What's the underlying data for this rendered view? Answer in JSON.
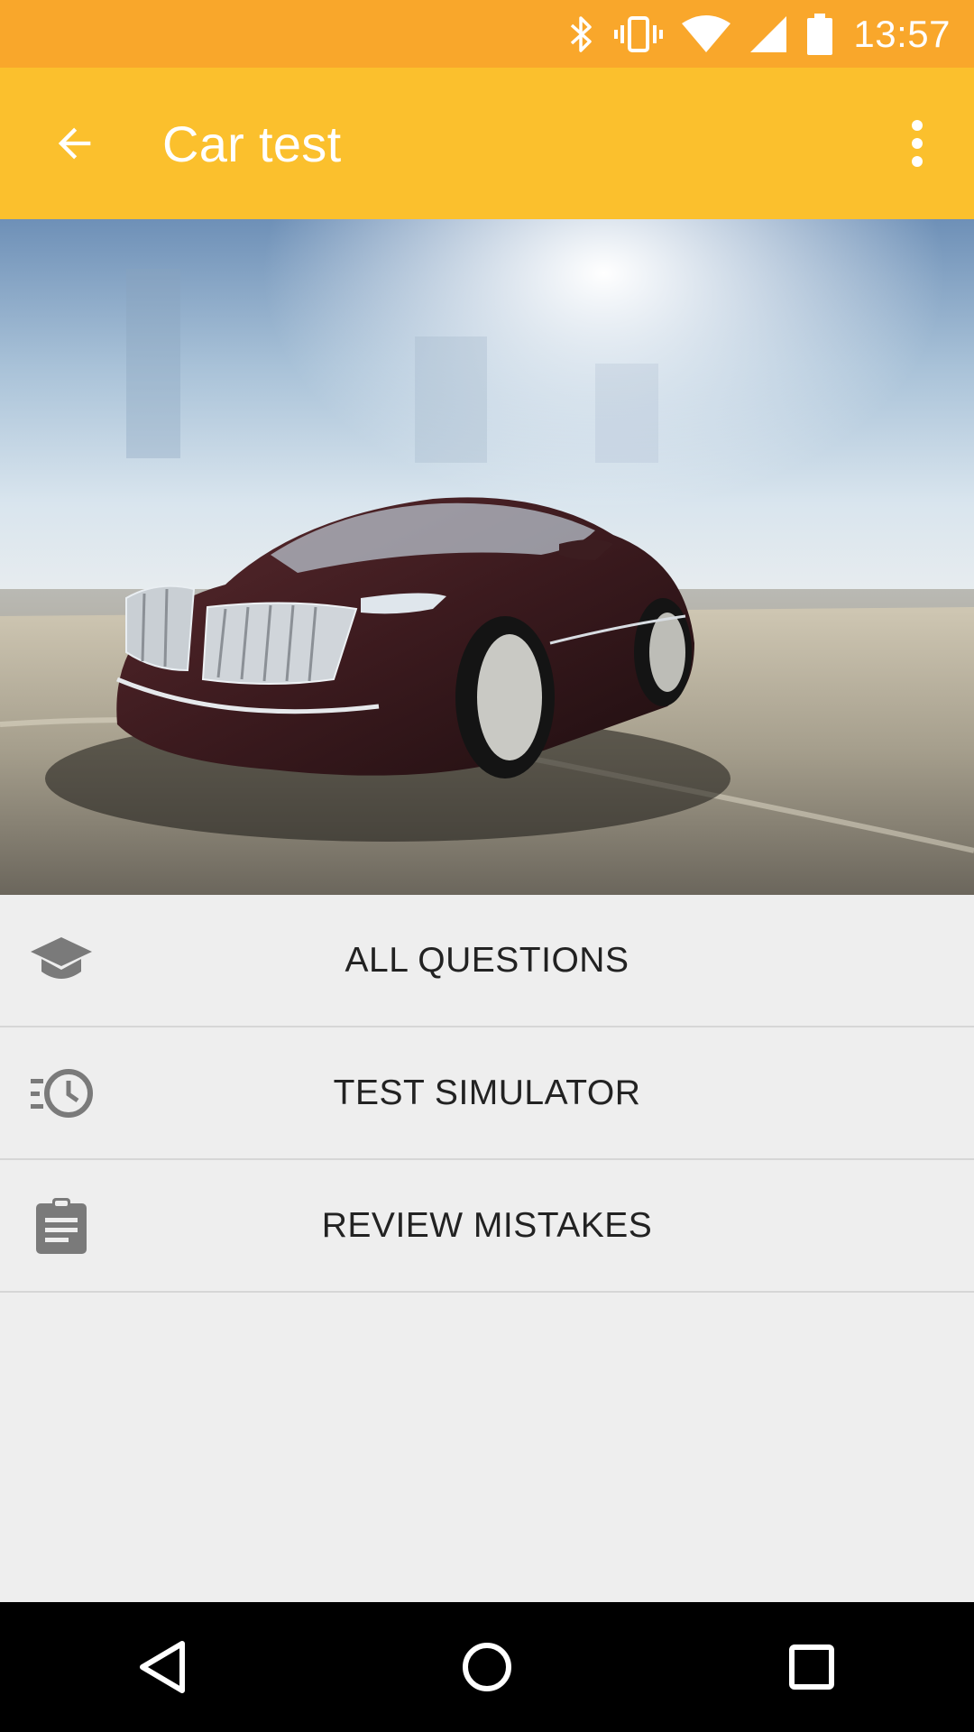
{
  "status_bar": {
    "time": "13:57",
    "icons": [
      "bluetooth-icon",
      "vibrate-icon",
      "wifi-icon",
      "cell-signal-icon",
      "battery-icon"
    ]
  },
  "app_bar": {
    "title": "Car test",
    "back_icon": "arrow-back-icon",
    "menu_icon": "more-vert-icon",
    "color": "#fbc02d",
    "status_color": "#f9a72b"
  },
  "hero": {
    "image": "car-photo"
  },
  "menu": {
    "items": [
      {
        "label": "ALL QUESTIONS",
        "icon": "graduation-cap-icon"
      },
      {
        "label": "TEST SIMULATOR",
        "icon": "clock-list-icon"
      },
      {
        "label": "REVIEW MISTAKES",
        "icon": "clipboard-icon"
      }
    ]
  },
  "nav_bar": {
    "icons": [
      "back-triangle-icon",
      "home-circle-icon",
      "recents-square-icon"
    ]
  }
}
